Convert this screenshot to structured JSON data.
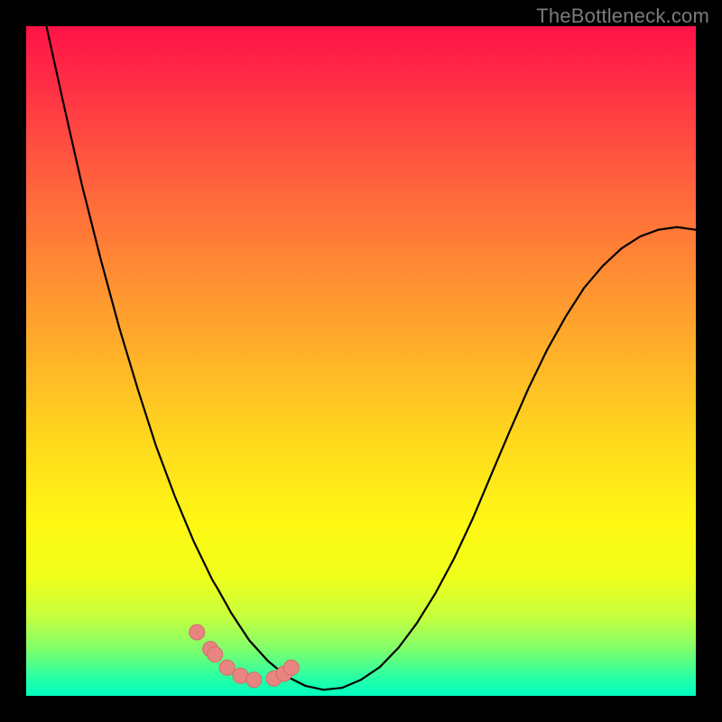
{
  "watermark": "TheBottleneck.com",
  "colors": {
    "frame": "#000000",
    "curve_stroke": "#000000",
    "marker_fill": "#e88581",
    "marker_stroke": "#d06e6a",
    "gradient_stops": [
      "#ff1348",
      "#ff2c45",
      "#ff5d3e",
      "#ff8a34",
      "#ffb428",
      "#ffd91d",
      "#fff714",
      "#f0ff1a",
      "#c8ff3c",
      "#7fff6b",
      "#2dffa2",
      "#00ffc0"
    ]
  },
  "chart_data": {
    "type": "line",
    "title": "",
    "xlabel": "",
    "ylabel": "",
    "xlim": [
      0,
      100
    ],
    "ylim": [
      0,
      100
    ],
    "grid": false,
    "series": [
      {
        "name": "curve",
        "x": [
          0.0,
          2.8,
          5.6,
          8.3,
          11.1,
          13.9,
          16.7,
          19.4,
          22.2,
          25.0,
          27.8,
          28.6,
          30.6,
          33.3,
          36.1,
          38.9,
          41.7,
          44.4,
          47.2,
          50.0,
          52.8,
          55.6,
          58.3,
          61.1,
          63.9,
          66.7,
          69.4,
          72.2,
          75.0,
          77.8,
          80.6,
          83.3,
          86.1,
          88.9,
          91.7,
          94.4,
          97.2,
          100.0
        ],
        "y": [
          115,
          101,
          88.3,
          76.4,
          65.3,
          55.0,
          45.7,
          37.3,
          29.8,
          23.1,
          17.3,
          16.0,
          12.4,
          8.3,
          5.2,
          2.9,
          1.5,
          0.9,
          1.2,
          2.4,
          4.3,
          7.2,
          10.8,
          15.3,
          20.5,
          26.5,
          32.9,
          39.5,
          45.9,
          51.7,
          56.7,
          60.9,
          64.2,
          66.8,
          68.6,
          69.6,
          70.0,
          69.6
        ]
      }
    ],
    "markers": {
      "name": "highlighted-points",
      "x": [
        25.5,
        27.5,
        28.2,
        30.0,
        32.0,
        34.0,
        37.0,
        38.5,
        39.6
      ],
      "y": [
        9.5,
        7.0,
        6.2,
        4.2,
        3.0,
        2.4,
        2.6,
        3.3,
        4.2
      ]
    }
  }
}
